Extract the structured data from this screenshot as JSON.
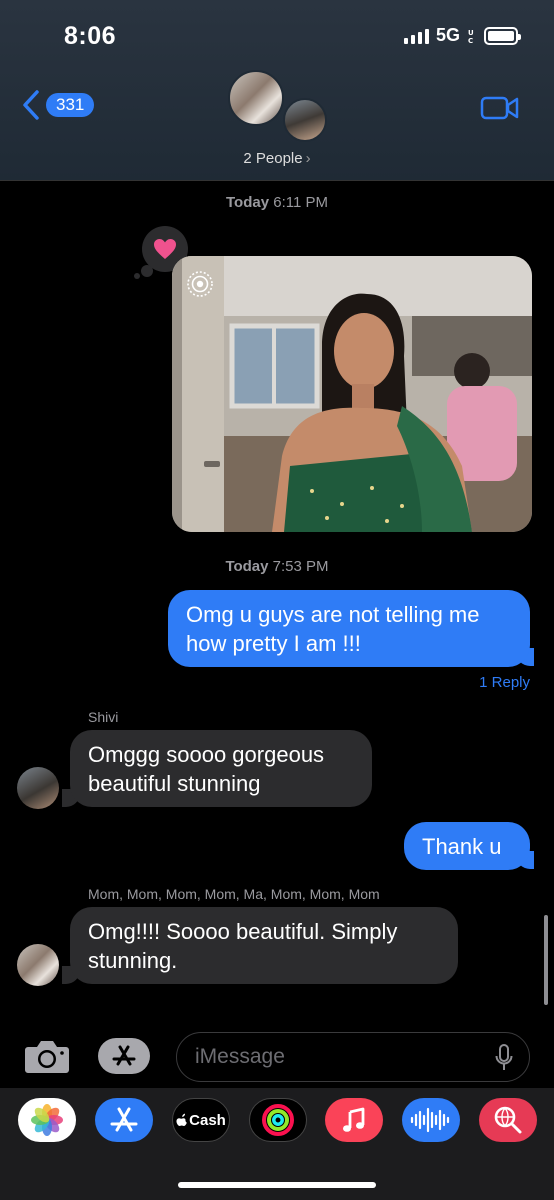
{
  "status_bar": {
    "time": "8:06",
    "network": "5G"
  },
  "header": {
    "back_count": "331",
    "people_label": "2 People",
    "chevron": "›"
  },
  "conversation": {
    "timestamp1": {
      "day": "Today",
      "time": "6:11 PM"
    },
    "timestamp2": {
      "day": "Today",
      "time": "7:53 PM"
    },
    "messages": [
      {
        "text": "Omg u guys are not telling me how pretty I am !!!"
      },
      {
        "sender": "Shivi",
        "text": "Omggg soooo gorgeous beautiful stunning"
      },
      {
        "text": "Thank u"
      },
      {
        "sender": "Mom, Mom, Mom, Mom, Ma, Mom, Mom, Mom",
        "text": "Omg!!!! Soooo beautiful.  Simply stunning."
      }
    ],
    "reply_link": "1 Reply"
  },
  "input": {
    "placeholder": "iMessage"
  },
  "app_drawer": {
    "apps": [
      {
        "icon": "photos-icon"
      },
      {
        "icon": "app-store-icon"
      },
      {
        "label": "Cash",
        "icon": "apple-cash-icon"
      },
      {
        "icon": "activity-icon"
      },
      {
        "icon": "music-icon"
      },
      {
        "icon": "audio-message-icon"
      },
      {
        "icon": "image-search-icon"
      }
    ]
  },
  "colors": {
    "accent": "#2f7cf6",
    "incoming": "#2c2c2e",
    "heart": "#f0528e"
  }
}
